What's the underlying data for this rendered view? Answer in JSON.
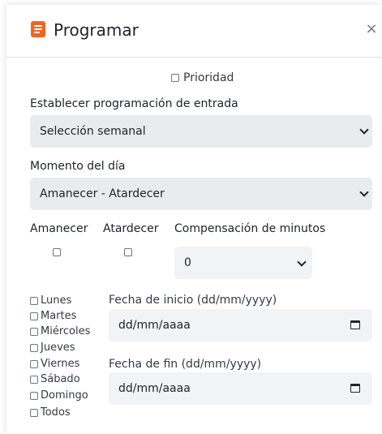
{
  "header": {
    "title": "Programar",
    "close_symbol": "×",
    "icon": "calendar-icon",
    "icon_color": "#f26522"
  },
  "priority": {
    "label": "Prioridad",
    "checked": false
  },
  "schedule_type": {
    "label": "Establecer programación de entrada",
    "selected": "Selección semanal"
  },
  "time_of_day": {
    "label": "Momento del día",
    "selected": "Amanecer - Atardecer"
  },
  "sunrise": {
    "label": "Amanecer",
    "checked": false
  },
  "sunset": {
    "label": "Atardecer",
    "checked": false
  },
  "offset": {
    "label": "Compensación de minutos",
    "selected": "0"
  },
  "days": [
    {
      "label": "Lunes",
      "checked": false
    },
    {
      "label": "Martes",
      "checked": false
    },
    {
      "label": "Miércoles",
      "checked": false
    },
    {
      "label": "Jueves",
      "checked": false
    },
    {
      "label": "Viernes",
      "checked": false
    },
    {
      "label": "Sábado",
      "checked": false
    },
    {
      "label": "Domingo",
      "checked": false
    },
    {
      "label": "Todos",
      "checked": false
    }
  ],
  "start_date": {
    "label": "Fecha de inicio (dd/mm/yyyy)",
    "placeholder": "dd/mm/aaaa"
  },
  "end_date": {
    "label": "Fecha de fin (dd/mm/yyyy)",
    "placeholder": "dd/mm/aaaa"
  }
}
